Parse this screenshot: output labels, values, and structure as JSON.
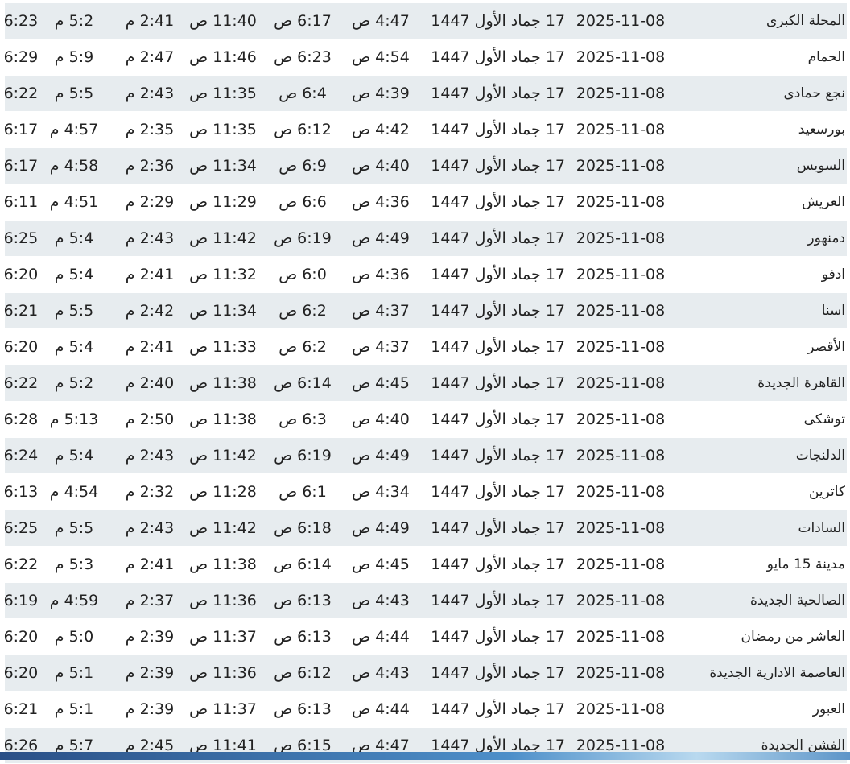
{
  "colors": {
    "row_shade": "#e7ecef",
    "text": "#222222",
    "bottom_bar": "#3f78b3"
  },
  "rows": [
    {
      "city": "المحلة الكبرى",
      "gregorian": "2025-11-08",
      "hijri": "17 جماد الأول 1447",
      "fajr": "4:47 ص",
      "sunrise": "6:17 ص",
      "dhuhr": "11:40 ص",
      "asr": "2:41 م",
      "maghrib": "5:2 م",
      "isha": "6:23 م"
    },
    {
      "city": "الحمام",
      "gregorian": "2025-11-08",
      "hijri": "17 جماد الأول 1447",
      "fajr": "4:54 ص",
      "sunrise": "6:23 ص",
      "dhuhr": "11:46 ص",
      "asr": "2:47 م",
      "maghrib": "5:9 م",
      "isha": "6:29 م"
    },
    {
      "city": "نجع حمادى",
      "gregorian": "2025-11-08",
      "hijri": "17 جماد الأول 1447",
      "fajr": "4:39 ص",
      "sunrise": "6:4 ص",
      "dhuhr": "11:35 ص",
      "asr": "2:43 م",
      "maghrib": "5:5 م",
      "isha": "6:22 م"
    },
    {
      "city": "بورسعيد",
      "gregorian": "2025-11-08",
      "hijri": "17 جماد الأول 1447",
      "fajr": "4:42 ص",
      "sunrise": "6:12 ص",
      "dhuhr": "11:35 ص",
      "asr": "2:35 م",
      "maghrib": "4:57 م",
      "isha": "6:17 م"
    },
    {
      "city": "السويس",
      "gregorian": "2025-11-08",
      "hijri": "17 جماد الأول 1447",
      "fajr": "4:40 ص",
      "sunrise": "6:9 ص",
      "dhuhr": "11:34 ص",
      "asr": "2:36 م",
      "maghrib": "4:58 م",
      "isha": "6:17 م"
    },
    {
      "city": "العريش",
      "gregorian": "2025-11-08",
      "hijri": "17 جماد الأول 1447",
      "fajr": "4:36 ص",
      "sunrise": "6:6 ص",
      "dhuhr": "11:29 ص",
      "asr": "2:29 م",
      "maghrib": "4:51 م",
      "isha": "6:11 م"
    },
    {
      "city": "دمنهور",
      "gregorian": "2025-11-08",
      "hijri": "17 جماد الأول 1447",
      "fajr": "4:49 ص",
      "sunrise": "6:19 ص",
      "dhuhr": "11:42 ص",
      "asr": "2:43 م",
      "maghrib": "5:4 م",
      "isha": "6:25 م"
    },
    {
      "city": "ادفو",
      "gregorian": "2025-11-08",
      "hijri": "17 جماد الأول 1447",
      "fajr": "4:36 ص",
      "sunrise": "6:0 ص",
      "dhuhr": "11:32 ص",
      "asr": "2:41 م",
      "maghrib": "5:4 م",
      "isha": "6:20 م"
    },
    {
      "city": "اسنا",
      "gregorian": "2025-11-08",
      "hijri": "17 جماد الأول 1447",
      "fajr": "4:37 ص",
      "sunrise": "6:2 ص",
      "dhuhr": "11:34 ص",
      "asr": "2:42 م",
      "maghrib": "5:5 م",
      "isha": "6:21 م"
    },
    {
      "city": "الأقصر",
      "gregorian": "2025-11-08",
      "hijri": "17 جماد الأول 1447",
      "fajr": "4:37 ص",
      "sunrise": "6:2 ص",
      "dhuhr": "11:33 ص",
      "asr": "2:41 م",
      "maghrib": "5:4 م",
      "isha": "6:20 م"
    },
    {
      "city": "القاهرة الجديدة",
      "gregorian": "2025-11-08",
      "hijri": "17 جماد الأول 1447",
      "fajr": "4:45 ص",
      "sunrise": "6:14 ص",
      "dhuhr": "11:38 ص",
      "asr": "2:40 م",
      "maghrib": "5:2 م",
      "isha": "6:22 م"
    },
    {
      "city": "توشكى",
      "gregorian": "2025-11-08",
      "hijri": "17 جماد الأول 1447",
      "fajr": "4:40 ص",
      "sunrise": "6:3 ص",
      "dhuhr": "11:38 ص",
      "asr": "2:50 م",
      "maghrib": "5:13 م",
      "isha": "6:28 م"
    },
    {
      "city": "الدلنجات",
      "gregorian": "2025-11-08",
      "hijri": "17 جماد الأول 1447",
      "fajr": "4:49 ص",
      "sunrise": "6:19 ص",
      "dhuhr": "11:42 ص",
      "asr": "2:43 م",
      "maghrib": "5:4 م",
      "isha": "6:24 م"
    },
    {
      "city": "كاترين",
      "gregorian": "2025-11-08",
      "hijri": "17 جماد الأول 1447",
      "fajr": "4:34 ص",
      "sunrise": "6:1 ص",
      "dhuhr": "11:28 ص",
      "asr": "2:32 م",
      "maghrib": "4:54 م",
      "isha": "6:13 م"
    },
    {
      "city": "السادات",
      "gregorian": "2025-11-08",
      "hijri": "17 جماد الأول 1447",
      "fajr": "4:49 ص",
      "sunrise": "6:18 ص",
      "dhuhr": "11:42 ص",
      "asr": "2:43 م",
      "maghrib": "5:5 م",
      "isha": "6:25 م"
    },
    {
      "city": "مدينة 15 مايو",
      "gregorian": "2025-11-08",
      "hijri": "17 جماد الأول 1447",
      "fajr": "4:45 ص",
      "sunrise": "6:14 ص",
      "dhuhr": "11:38 ص",
      "asr": "2:41 م",
      "maghrib": "5:3 م",
      "isha": "6:22 م"
    },
    {
      "city": "الصالحية الجديدة",
      "gregorian": "2025-11-08",
      "hijri": "17 جماد الأول 1447",
      "fajr": "4:43 ص",
      "sunrise": "6:13 ص",
      "dhuhr": "11:36 ص",
      "asr": "2:37 م",
      "maghrib": "4:59 م",
      "isha": "6:19 م"
    },
    {
      "city": "العاشر من رمضان",
      "gregorian": "2025-11-08",
      "hijri": "17 جماد الأول 1447",
      "fajr": "4:44 ص",
      "sunrise": "6:13 ص",
      "dhuhr": "11:37 ص",
      "asr": "2:39 م",
      "maghrib": "5:0 م",
      "isha": "6:20 م"
    },
    {
      "city": "العاصمة الادارية الجديدة",
      "gregorian": "2025-11-08",
      "hijri": "17 جماد الأول 1447",
      "fajr": "4:43 ص",
      "sunrise": "6:12 ص",
      "dhuhr": "11:36 ص",
      "asr": "2:39 م",
      "maghrib": "5:1 م",
      "isha": "6:20 م"
    },
    {
      "city": "العبور",
      "gregorian": "2025-11-08",
      "hijri": "17 جماد الأول 1447",
      "fajr": "4:44 ص",
      "sunrise": "6:13 ص",
      "dhuhr": "11:37 ص",
      "asr": "2:39 م",
      "maghrib": "5:1 م",
      "isha": "6:21 م"
    },
    {
      "city": "الفشن الجديدة",
      "gregorian": "2025-11-08",
      "hijri": "17 جماد الأول 1447",
      "fajr": "4:47 ص",
      "sunrise": "6:15 ص",
      "dhuhr": "11:41 ص",
      "asr": "2:45 م",
      "maghrib": "5:7 م",
      "isha": "6:26 م"
    }
  ]
}
